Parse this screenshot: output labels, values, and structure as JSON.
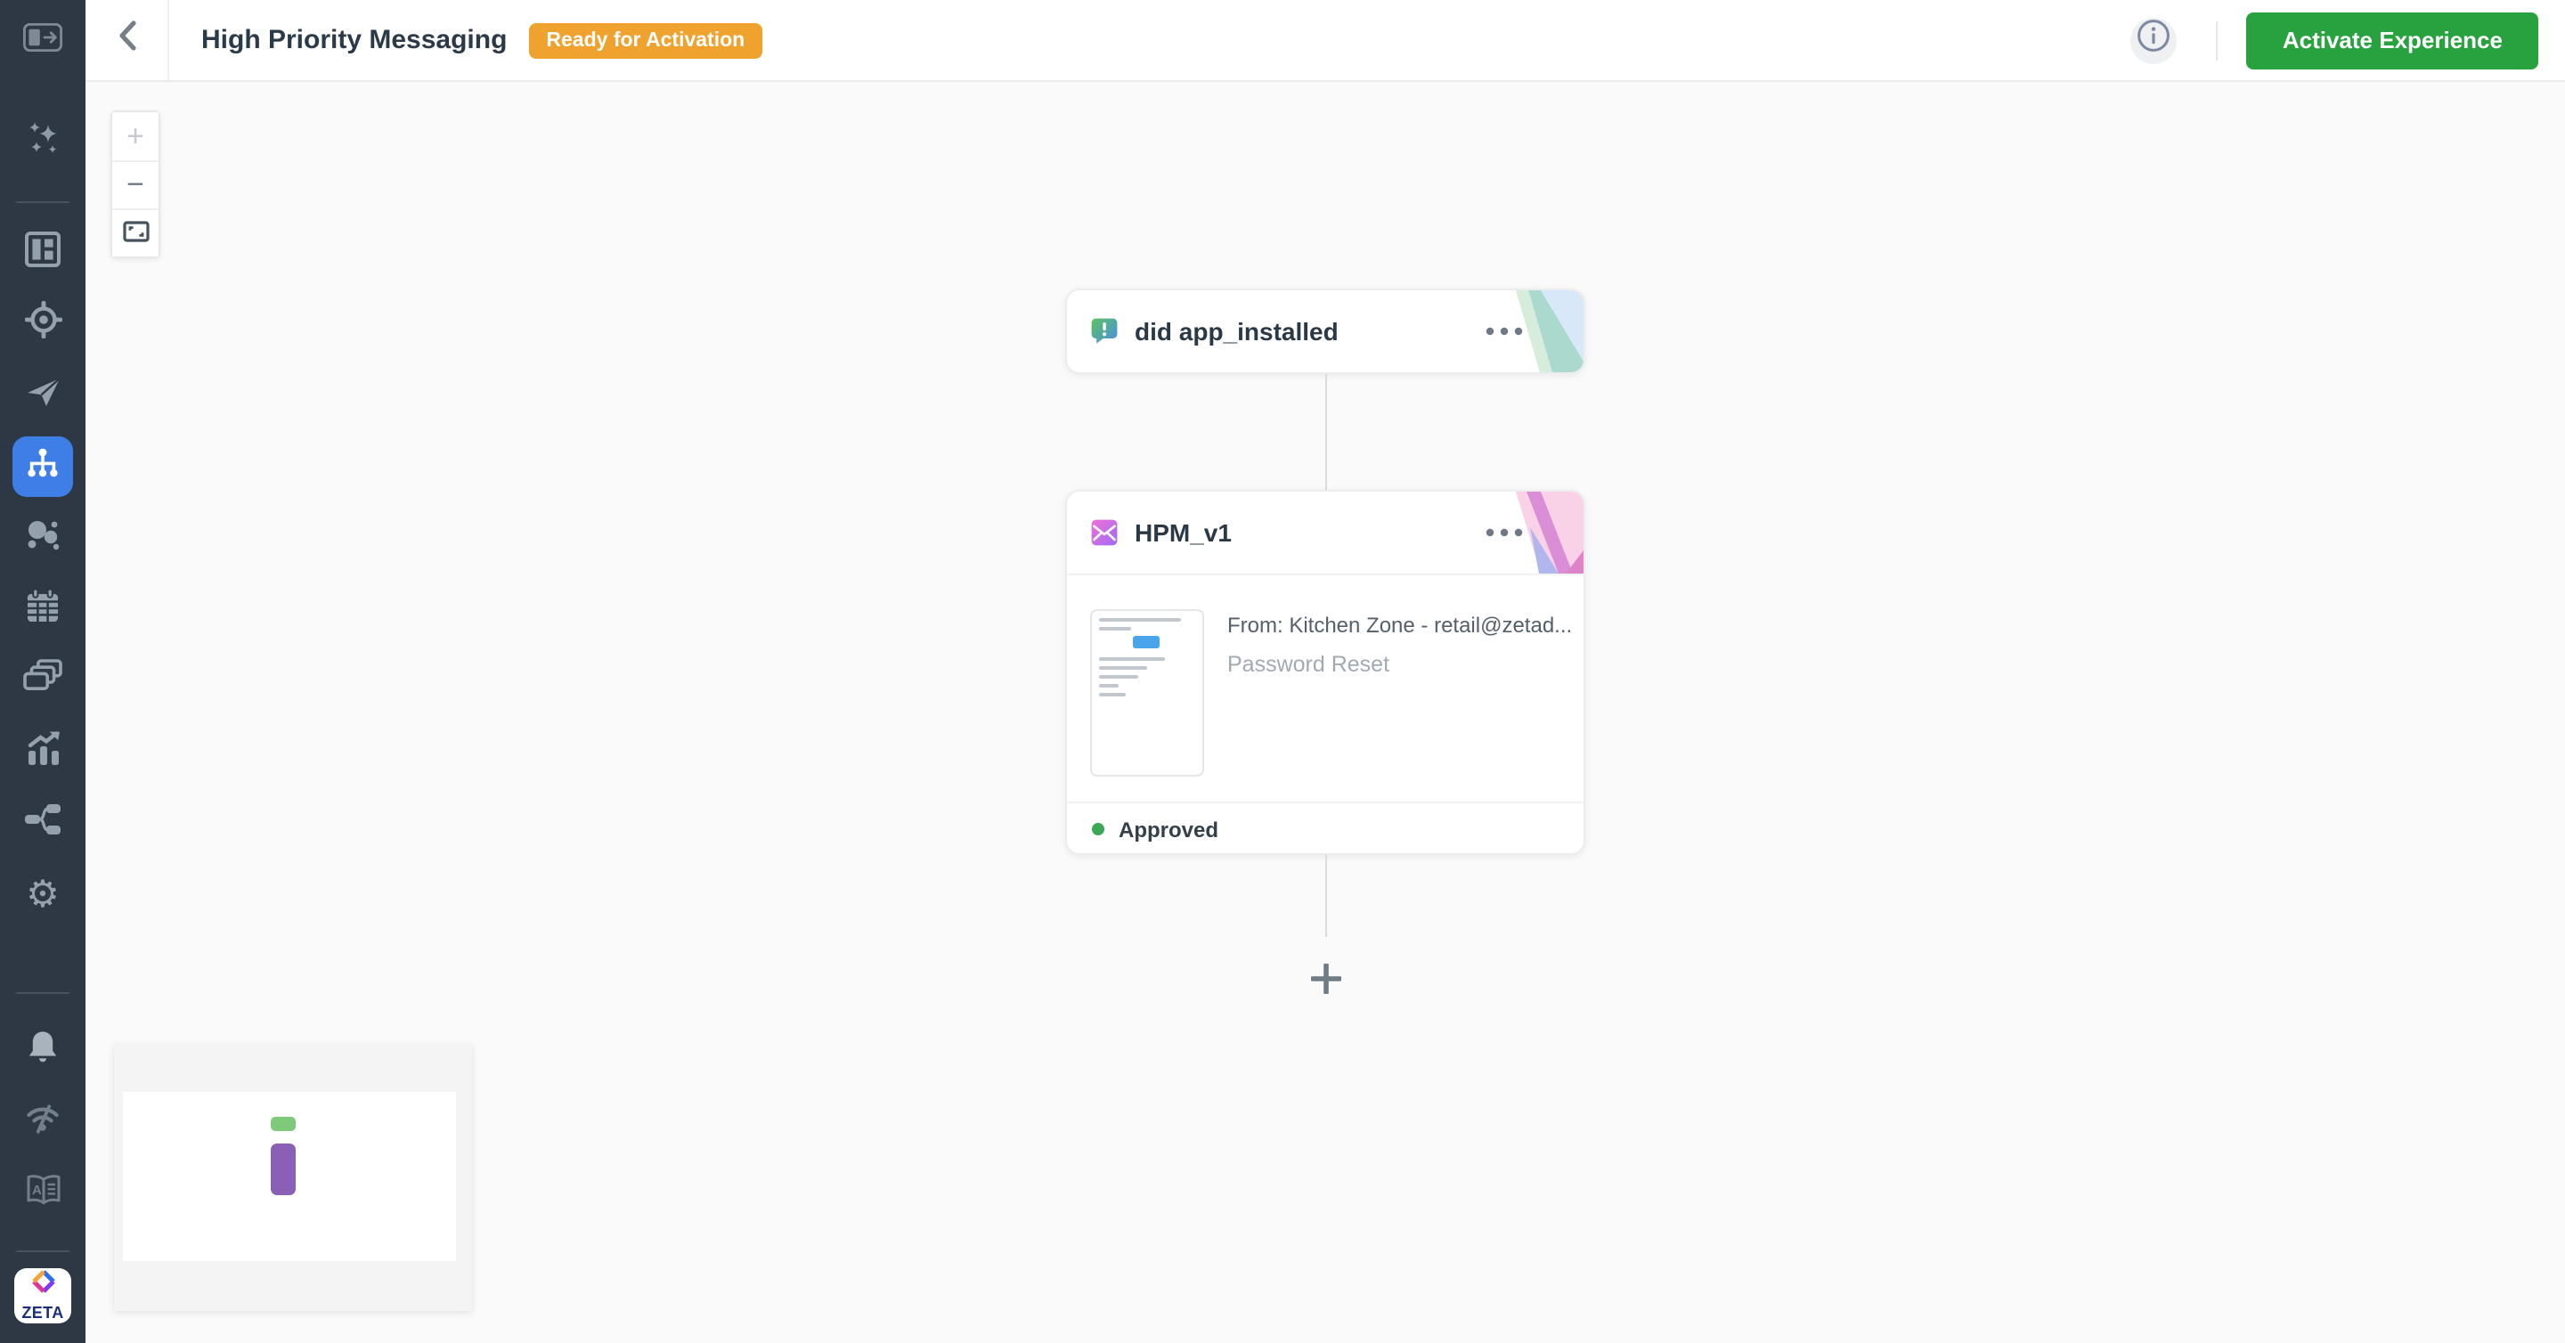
{
  "header": {
    "title": "High Priority Messaging",
    "status_badge": "Ready for Activation",
    "activate_button": "Activate Experience"
  },
  "sidebar": {
    "icons": [
      "sidebar-expand",
      "sparkles",
      "dashboard",
      "target",
      "send",
      "journey-sitemap",
      "audience-bubbles",
      "calendar",
      "campaign-cards",
      "analytics-chart",
      "flow-split",
      "settings-gear",
      "notifications-bell",
      "signal",
      "knowledge-book"
    ],
    "active_icon": "journey-sitemap",
    "logo_text": "ZETA"
  },
  "canvas": {
    "zoom_controls": {
      "zoom_in": "+",
      "zoom_out": "−",
      "fit_view": "fit-view-icon"
    },
    "nodes": [
      {
        "id": "trigger",
        "title": "did app_installed",
        "icon": "event-bubble-icon",
        "menu": "ellipsis"
      },
      {
        "id": "email",
        "title": "HPM_v1",
        "icon": "email-envelope-icon",
        "menu": "ellipsis",
        "from_line": "From: Kitchen Zone - retail@zetad...",
        "subject_line": "Password Reset",
        "status": "Approved",
        "preview_lines": [
          {
            "type": "bar",
            "w": 86
          },
          {
            "type": "bar",
            "w": 34
          },
          {
            "type": "button"
          },
          {
            "type": "bar",
            "w": 68
          },
          {
            "type": "bar",
            "w": 50
          },
          {
            "type": "bar",
            "w": 40
          },
          {
            "type": "bar",
            "w": 20
          },
          {
            "type": "bar",
            "w": 28
          }
        ]
      }
    ],
    "add_step": "+"
  },
  "colors": {
    "sidebar_bg": "#2e3845",
    "active_item_blue": "#3e7ee6",
    "badge_orange": "#f0a22f",
    "activate_green": "#28a23e",
    "approved_green": "#3ba757",
    "mini_node_green": "#7fca7a",
    "mini_node_purple": "#8a60b6",
    "connector_gray": "#d9dcdf"
  }
}
